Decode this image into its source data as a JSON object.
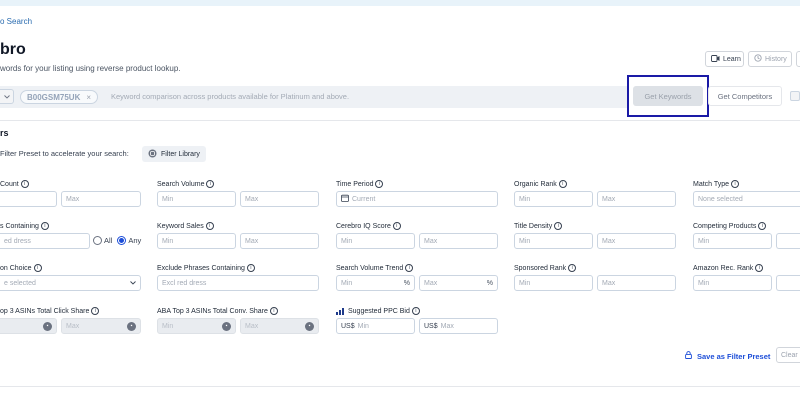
{
  "header": {
    "back_link": "o Search",
    "title": "bro",
    "subtitle": "words for your listing using reverse product lookup.",
    "learn_label": "Learn",
    "history_label": "History"
  },
  "search": {
    "chip_label": "B00GSM75UK",
    "chip_close": "×",
    "placeholder": "Keyword comparison across products available for Platinum and above.",
    "get_keywords_label": "Get Keywords",
    "get_competitors_label": "Get Competitors"
  },
  "filters": {
    "heading": "rs",
    "preset_text": "Filter Preset to accelerate your search:",
    "filter_library_label": "Filter Library",
    "labels": {
      "count": "Count",
      "search_volume": "Search Volume",
      "time_period": "Time Period",
      "organic_rank": "Organic Rank",
      "match_type": "Match Type",
      "containing": "s Containing",
      "keyword_sales": "Keyword Sales",
      "cerebro_iq": "Cerebro IQ Score",
      "title_density": "Title Density",
      "competing_products": "Competing Products",
      "choice": "on Choice",
      "exclude_phrases": "Exclude Phrases Containing",
      "sv_trend": "Search Volume Trend",
      "sponsored_rank": "Sponsored Rank",
      "amazon_rec_rank": "Amazon Rec. Rank",
      "aba_click": "op 3 ASINs Total Click Share",
      "aba_conv": "ABA Top 3 ASINs Total Conv. Share",
      "ppc_bid": "Suggested PPC Bid"
    },
    "placeholders": {
      "min": "Min",
      "max": "Max",
      "current": "Current",
      "none_selected": "None selected",
      "none_selected_cut": "e selected",
      "red_dress_cut": "ed dress",
      "excl_dress": "Excl red dress",
      "percent": "%",
      "usd": "US$"
    },
    "radio_all": "All",
    "radio_any": "Any",
    "save_preset_label": "Save as Filter Preset",
    "clear_label": "Clear"
  },
  "colors": {
    "accent": "#1d4ed8",
    "highlight_box": "#1a1aa6"
  }
}
